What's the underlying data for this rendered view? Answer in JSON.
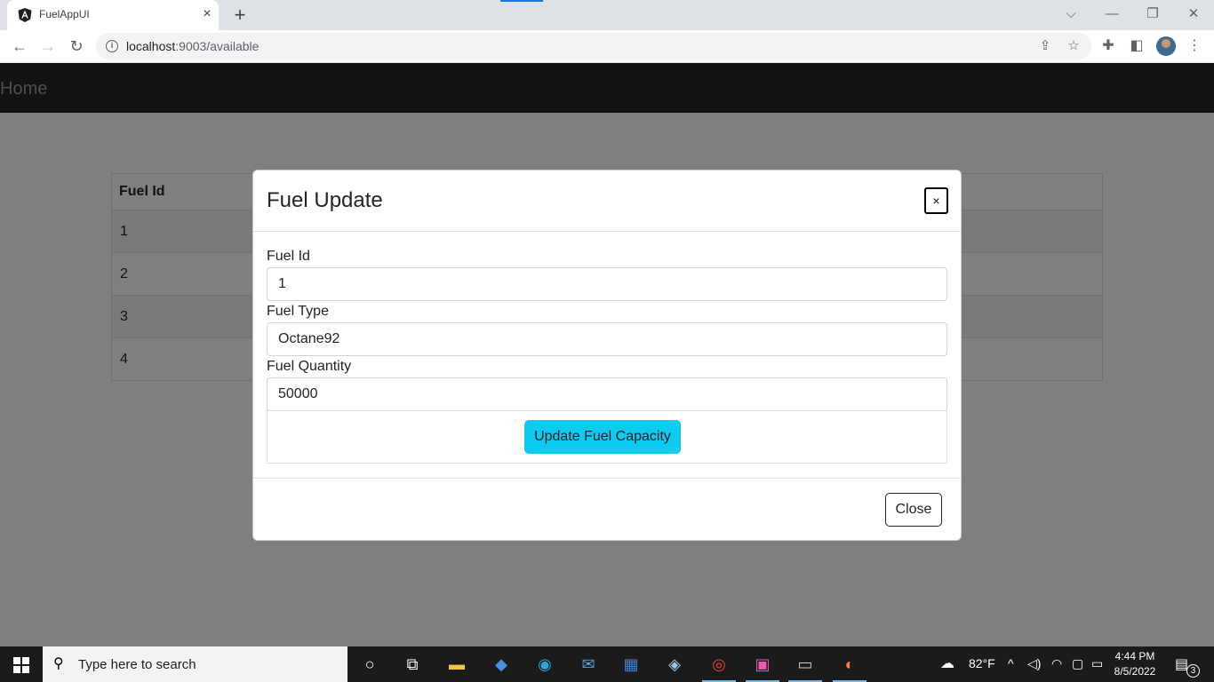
{
  "browser": {
    "tab_title": "FuelAppUI",
    "tab_close": "×",
    "new_tab": "+",
    "url_host": "localhost",
    "url_rest": ":9003/available",
    "window_controls": {
      "collapse": "⌵",
      "minimize": "—",
      "restore": "❐",
      "close": "✕"
    }
  },
  "navbar": {
    "brand": "Home"
  },
  "table": {
    "columns": [
      "Fuel Id"
    ],
    "rows": [
      "1",
      "2",
      "3",
      "4"
    ]
  },
  "modal": {
    "title": "Fuel Update",
    "close_x": "×",
    "fields": [
      {
        "label": "Fuel Id",
        "value": "1"
      },
      {
        "label": "Fuel Type",
        "value": "Octane92"
      },
      {
        "label": "Fuel Quantity",
        "value": "50000"
      }
    ],
    "submit_label": "Update Fuel Capacity",
    "footer_close_label": "Close"
  },
  "taskbar": {
    "search_placeholder": "Type here to search",
    "weather_temp": "82°F",
    "time": "4:44 PM",
    "date": "8/5/2022",
    "notification_count": "3"
  },
  "colors": {
    "navbar_bg": "#212529",
    "primary_button": "#0dcaf0",
    "backdrop": "rgba(0,0,0,0.5)",
    "taskbar_bg": "#1b1b1b"
  }
}
